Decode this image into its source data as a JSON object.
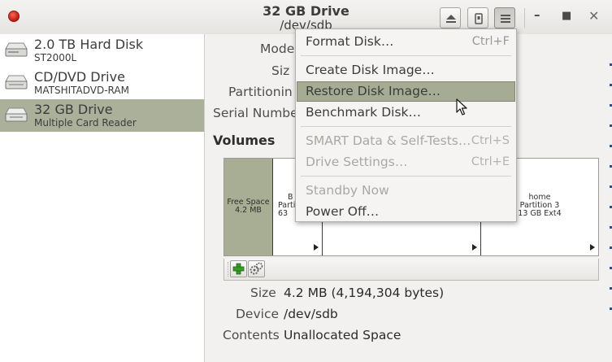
{
  "window": {
    "title": "32 GB Drive",
    "subtitle": "/dev/sdb"
  },
  "sidebar": {
    "items": [
      {
        "name": "2.0 TB Hard Disk",
        "sub": "ST2000L",
        "icon": "hard-disk-icon",
        "selected": false
      },
      {
        "name": "CD/DVD Drive",
        "sub": "MATSHITADVD-RAM",
        "icon": "optical-drive-icon",
        "selected": false
      },
      {
        "name": "32 GB Drive",
        "sub": "Multiple Card  Reader",
        "icon": "card-reader-icon",
        "selected": true
      }
    ]
  },
  "drive_info": {
    "model_label": "Mode",
    "size_label": "Siz",
    "partitioning_label": "Partitionin",
    "serial_label": "Serial Numbe"
  },
  "volumes": {
    "heading": "Volumes",
    "segments": [
      {
        "line1": "Free Space",
        "line2": "4.2 MB",
        "line3": ""
      },
      {
        "line1": "B",
        "line2": "Parti",
        "line3": "63"
      },
      {
        "line1": "",
        "line2": "",
        "line3": ""
      },
      {
        "line1": "home",
        "line2": "Partition 3",
        "line3": "13 GB Ext4"
      }
    ]
  },
  "volume_details": {
    "size_label": "Size",
    "size_value": "4.2 MB (4,194,304 bytes)",
    "device_label": "Device",
    "device_value": "/dev/sdb",
    "contents_label": "Contents",
    "contents_value": "Unallocated Space"
  },
  "menu": {
    "items": [
      {
        "label": "Format Disk…",
        "shortcut": "Ctrl+F",
        "disabled": false
      },
      {
        "label": "Create Disk Image…",
        "shortcut": "",
        "disabled": false
      },
      {
        "label": "Restore Disk Image…",
        "shortcut": "",
        "disabled": false,
        "highlighted": true
      },
      {
        "label": "Benchmark Disk…",
        "shortcut": "",
        "disabled": false
      },
      {
        "label": "SMART Data & Self-Tests…",
        "shortcut": "Ctrl+S",
        "disabled": true
      },
      {
        "label": "Drive Settings…",
        "shortcut": "Ctrl+E",
        "disabled": true
      },
      {
        "label": "Standby Now",
        "shortcut": "",
        "disabled": true
      },
      {
        "label": "Power Off…",
        "shortcut": "",
        "disabled": false
      }
    ]
  },
  "colors": {
    "selection": "#aab09a",
    "menu_highlight": "#a6ac93",
    "close_button": "#d62b1c"
  }
}
